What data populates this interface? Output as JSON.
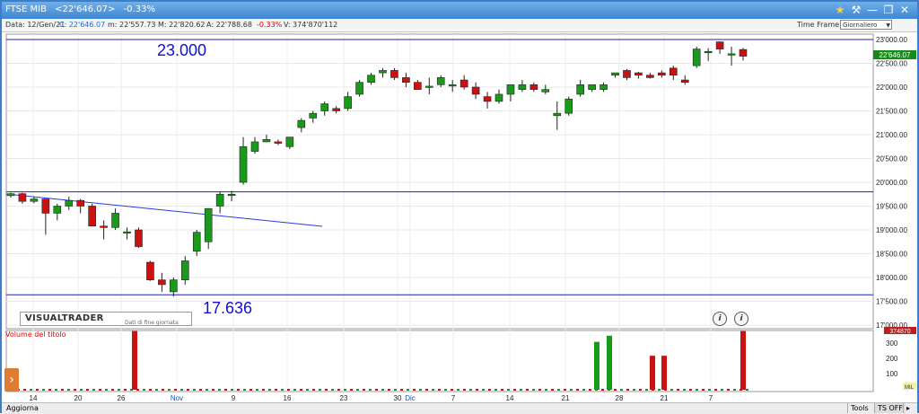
{
  "window": {
    "title": [
      "FTSE MIB",
      "<22'646.07>",
      "-0.33%"
    ]
  },
  "infobar": {
    "date": "Data: 12/Gen/21",
    "close": "C: 22'646.07",
    "low": "m: 22'557.73",
    "high": "M: 22'820.62",
    "open": "A: 22'788.68",
    "change": "-0.33%",
    "volume": "V: 374'870'112",
    "time_frame_label": "Time Frame",
    "time_frame_value": "Giornaliero"
  },
  "chart": {
    "levels": {
      "top": "23.000",
      "bottom": "17.636"
    },
    "logo": "VISUALTRADER",
    "logo_sub": "Dati di fine giornata",
    "volume_title": "Volume del titolo",
    "last_price": "22'646.07",
    "vol_last": "374870",
    "vol_unit": "MIL",
    "colors": {
      "up": "#1a9a1a",
      "down": "#cc1111",
      "hline": "#1f1fbd",
      "trend": "#2a3ae0",
      "title": "#3f86d2"
    }
  },
  "chart_data": {
    "type": "candlestick",
    "y_ticks": [
      "23'000.00",
      "22'500.00",
      "22'000.00",
      "21'500.00",
      "21'000.00",
      "20'500.00",
      "20'000.00",
      "19'500.00",
      "19'000.00",
      "18'500.00",
      "18'000.00",
      "17'500.00",
      "17'000.00"
    ],
    "y_range": [
      17000,
      23000
    ],
    "volume_ticks": [
      "300",
      "200",
      "100"
    ],
    "x_labels": [
      "14",
      "20",
      "26",
      "Nov",
      "9",
      "16",
      "23",
      "30",
      "Dic",
      "7",
      "14",
      "21",
      "28",
      "21",
      "7"
    ],
    "horizontal_levels": [
      23000,
      19800,
      17636
    ],
    "candles": [
      [
        19720,
        19780,
        19680,
        19760
      ],
      [
        19760,
        19780,
        19550,
        19600
      ],
      [
        19600,
        19700,
        19560,
        19650
      ],
      [
        19650,
        19650,
        18900,
        19350
      ],
      [
        19350,
        19550,
        19200,
        19500
      ],
      [
        19500,
        19700,
        19420,
        19620
      ],
      [
        19620,
        19650,
        19350,
        19500
      ],
      [
        19500,
        19550,
        19100,
        19080
      ],
      [
        19080,
        19200,
        18800,
        19050
      ],
      [
        19050,
        19450,
        19000,
        19350
      ],
      [
        18950,
        19050,
        18800,
        18960
      ],
      [
        19000,
        19050,
        18620,
        18650
      ],
      [
        18320,
        18350,
        17930,
        17950
      ],
      [
        17950,
        18100,
        17700,
        17850
      ],
      [
        17700,
        18000,
        17600,
        17950
      ],
      [
        17950,
        18450,
        17850,
        18350
      ],
      [
        18550,
        19000,
        18450,
        18950
      ],
      [
        18750,
        19400,
        18600,
        19450
      ],
      [
        19500,
        19800,
        19350,
        19750
      ],
      [
        19750,
        19820,
        19600,
        19750
      ],
      [
        20000,
        20950,
        19950,
        20750
      ],
      [
        20650,
        20950,
        20600,
        20850
      ],
      [
        20850,
        21000,
        20850,
        20900
      ],
      [
        20850,
        20900,
        20780,
        20820
      ],
      [
        20750,
        20950,
        20700,
        20950
      ],
      [
        21150,
        21350,
        21050,
        21300
      ],
      [
        21350,
        21500,
        21250,
        21450
      ],
      [
        21500,
        21700,
        21400,
        21650
      ],
      [
        21550,
        21600,
        21450,
        21500
      ],
      [
        21550,
        21900,
        21500,
        21800
      ],
      [
        21850,
        22150,
        21800,
        22100
      ],
      [
        22100,
        22300,
        22050,
        22250
      ],
      [
        22300,
        22400,
        22200,
        22350
      ],
      [
        22350,
        22400,
        22150,
        22200
      ],
      [
        22200,
        22300,
        22000,
        22100
      ],
      [
        22100,
        22150,
        21950,
        21950
      ],
      [
        22000,
        22200,
        21850,
        22020
      ],
      [
        22050,
        22250,
        22000,
        22200
      ],
      [
        22050,
        22150,
        21900,
        22050
      ],
      [
        22150,
        22250,
        21950,
        22000
      ],
      [
        22000,
        22100,
        21750,
        21850
      ],
      [
        21800,
        21900,
        21550,
        21700
      ],
      [
        21700,
        21950,
        21650,
        21850
      ],
      [
        21850,
        22000,
        21700,
        22050
      ],
      [
        21950,
        22150,
        21900,
        22050
      ],
      [
        22050,
        22100,
        21900,
        21950
      ],
      [
        21900,
        22050,
        21850,
        21950
      ],
      [
        21400,
        21700,
        21100,
        21450
      ],
      [
        21450,
        21800,
        21400,
        21750
      ],
      [
        21850,
        22150,
        21800,
        22050
      ],
      [
        21950,
        22050,
        21900,
        22050
      ],
      [
        21950,
        22100,
        21900,
        22050
      ],
      [
        22250,
        22300,
        22200,
        22300
      ],
      [
        22350,
        22380,
        22150,
        22200
      ],
      [
        22300,
        22320,
        22180,
        22250
      ],
      [
        22250,
        22300,
        22180,
        22200
      ],
      [
        22300,
        22350,
        22200,
        22250
      ],
      [
        22400,
        22450,
        22150,
        22250
      ],
      [
        22150,
        22250,
        22050,
        22100
      ],
      [
        22450,
        22850,
        22400,
        22800
      ],
      [
        22750,
        22820,
        22550,
        22750
      ],
      [
        22950,
        22960,
        22700,
        22800
      ],
      [
        22700,
        22850,
        22450,
        22700
      ],
      [
        22790,
        22820,
        22560,
        22650
      ]
    ],
    "volumes": [
      380,
      10,
      310,
      10,
      10,
      10,
      10,
      10,
      350,
      10,
      10,
      10,
      220,
      220,
      380
    ],
    "volume_positions": [
      148,
      0,
      663,
      0,
      0,
      0,
      0,
      0,
      677,
      0,
      0,
      0,
      725,
      738,
      826
    ]
  }
}
